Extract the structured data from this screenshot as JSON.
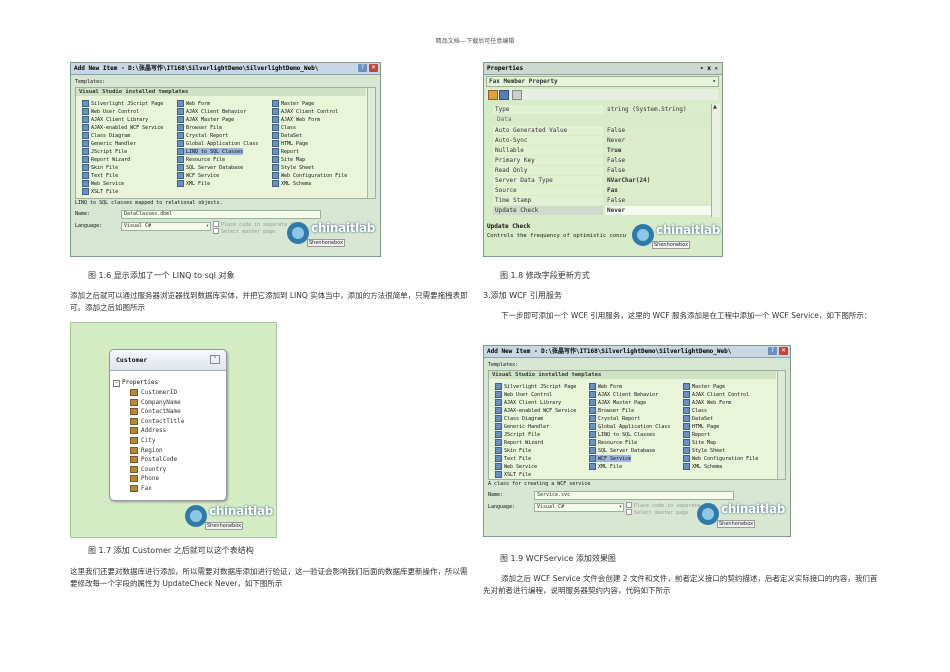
{
  "page": {
    "header_note": "精品文档---下载后可任意编辑"
  },
  "watermark": {
    "text": "chinaitlab",
    "sub": "Shenhonebox"
  },
  "add_item_dialog": {
    "title": "Add New Item - D:\\张晶写作\\IT168\\SilverlightDemo\\SilverlightDemo_Web\\",
    "templates_label": "Templates:",
    "group_label": "Visual Studio installed templates",
    "templates": [
      [
        "Silverlight JScript Page",
        "Web Form",
        "Master Page"
      ],
      [
        "Web User Control",
        "AJAX Client Behavior",
        "AJAX Client Control"
      ],
      [
        "AJAX Client Library",
        "AJAX Master Page",
        "AJAX Web Form"
      ],
      [
        "AJAX-enabled WCF Service",
        "Browser File",
        "Class"
      ],
      [
        "Class Diagram",
        "Crystal Report",
        "DataSet"
      ],
      [
        "Generic Handler",
        "Global Application Class",
        "HTML Page"
      ],
      [
        "JScript File",
        "LINQ to SQL Classes",
        "Report"
      ],
      [
        "Report Wizard",
        "Resource File",
        "Site Map"
      ],
      [
        "Skin File",
        "SQL Server Database",
        "Style Sheet"
      ],
      [
        "Text File",
        "WCF Service",
        "Web Configuration File"
      ],
      [
        "Web Service",
        "XML File",
        "XML Schema"
      ],
      [
        "XSLT File",
        "",
        ""
      ]
    ],
    "name_label": "Name:",
    "language_label": "Language:",
    "language_value": "Visual C#",
    "option_separate": "Place code in separate file",
    "option_master": "Select master page"
  },
  "dialog_linq": {
    "description": "LINQ to SQL classes mapped to relational objects.",
    "name_value": "DataClasses.dbml"
  },
  "dialog_wcf": {
    "description": "A class for creating a WCF service",
    "name_value": "Service.svc"
  },
  "properties": {
    "title": "Properties",
    "title_buttons": "▾ ⅹ ✕",
    "object": "Fax Member Property",
    "rows_top": [
      {
        "name": "Type",
        "value": "string (System.String)"
      }
    ],
    "section": "Data",
    "rows": [
      {
        "name": "Auto Generated Value",
        "value": "False"
      },
      {
        "name": "Auto-Sync",
        "value": "Never"
      },
      {
        "name": "Nullable",
        "value": "True"
      },
      {
        "name": "Primary Key",
        "value": "False"
      },
      {
        "name": "Read Only",
        "value": "False"
      },
      {
        "name": "Server Data Type",
        "value": "NVarChar(24)"
      },
      {
        "name": "Source",
        "value": "Fax"
      },
      {
        "name": "Time Stamp",
        "value": "False"
      },
      {
        "name": "Update Check",
        "value": "Never"
      }
    ],
    "desc_title": "Update Check",
    "desc_text": "Controls the frequency of optimistic concu"
  },
  "customer": {
    "title": "Customer",
    "properties_label": "Properties",
    "items": [
      "CustomerID",
      "CompanyName",
      "ContactName",
      "ContactTitle",
      "Address",
      "City",
      "Region",
      "PostalCode",
      "Country",
      "Phone",
      "Fax"
    ]
  },
  "captions": {
    "fig16": "图 1.6 显示添加了一个 LINQ to sql 对象",
    "fig17": "图 1.7 添加 Customer 之后就可以这个表结构",
    "fig18": "图 1.8 修改字段更新方式",
    "fig19": "图 1.9 WCFService 添加效果图"
  },
  "text": {
    "p_left1": "添加之后就可以通过服务器浏览器找到数据库实体，并把它添加到 LINQ 实体当中，添加的方法很简单，只需要拖拽表即可。添加之后如图所示",
    "p_left2": "这里我们还要对数据库进行添加，所以需要对数据库添加进行验证，这一验证会影响我们后面的数据库更新操作，所以需要修改每一个字段的属性为 UpdateCheck Never，如下图所示",
    "heading_wcf": "3.添加 WCF 引用服务",
    "p_right1": "下一步即可添加一个 WCF 引用服务，这里的 WCF 服务添加是在工程中添加一个 WCF Service，如下图所示：",
    "p_right2": "添加之后 WCF Service 文件会创建 2 文件和文件，前者定义接口的契约描述，后者定义实际接口的内容，我们首先对前者进行编程，说明服务器契约内容，代码如下所示"
  }
}
